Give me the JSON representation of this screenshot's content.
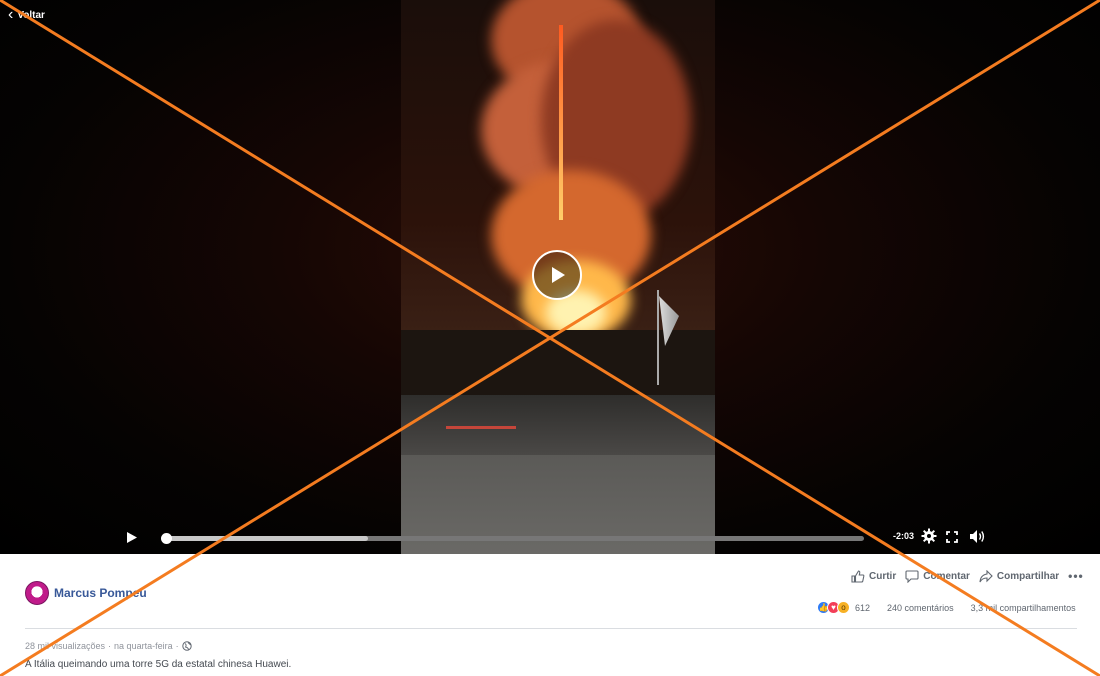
{
  "nav": {
    "back_label": "Voltar"
  },
  "player": {
    "time_remaining": "-2:03",
    "progress_fraction": 0.0,
    "buffered_fraction": 0.29
  },
  "post": {
    "author": "Marcus Pompeu",
    "actions": {
      "like": "Curtir",
      "comment": "Comentar",
      "share": "Compartilhar",
      "more": "•••"
    },
    "reactions_count": "612",
    "comments_count": "240 comentários",
    "shares_count": "3,3 mil compartilhamentos",
    "views": "28 mil visualizações",
    "posted_when": "na quarta-feira",
    "meta_separator": "·",
    "caption": "A Itália queimando uma torre 5G da estatal chinesa Huawei."
  },
  "colors": {
    "strike_x": "#f47c20",
    "author_link": "#385898",
    "like_blue": "#2e7bf6",
    "love_red": "#f33e58",
    "wow_yellow": "#f7b125"
  },
  "icons": {
    "back": "chevron-left-icon",
    "play": "play-icon",
    "settings": "gear-icon",
    "fullscreen": "fullscreen-icon",
    "volume": "speaker-icon",
    "like": "thumbs-up-icon",
    "comment": "speech-bubble-icon",
    "share": "share-arrow-icon",
    "privacy": "globe-icon"
  }
}
